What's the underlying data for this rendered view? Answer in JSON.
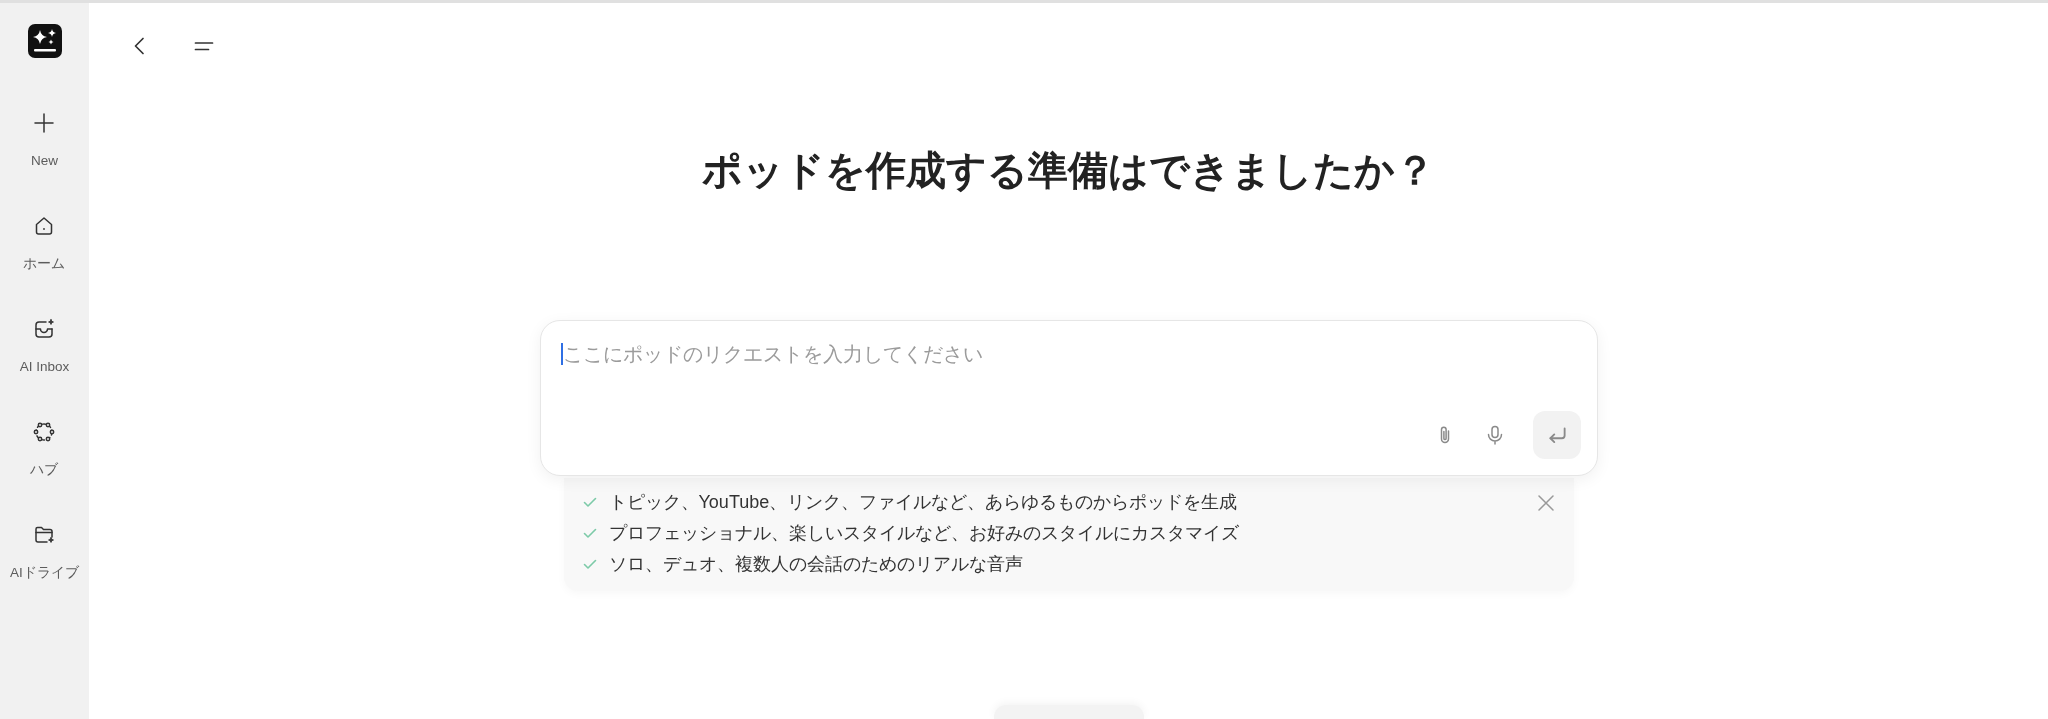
{
  "sidebar": {
    "items": [
      {
        "label": "New"
      },
      {
        "label": "ホーム"
      },
      {
        "label": "AI Inbox"
      },
      {
        "label": "ハブ"
      },
      {
        "label": "AIドライブ"
      }
    ]
  },
  "title": "ポッドを作成する準備はできましたか？",
  "composer": {
    "placeholder": "ここにポッドのリクエストを入力してください",
    "send_button": {
      "disabled": true
    }
  },
  "hints": {
    "items": [
      "トピック、YouTube、リンク、ファイルなど、あらゆるものからポッドを生成",
      "プロフェッショナル、楽しいスタイルなど、お好みのスタイルにカスタマイズ",
      "ソロ、デュオ、複数人の会話のためのリアルな音声"
    ]
  }
}
